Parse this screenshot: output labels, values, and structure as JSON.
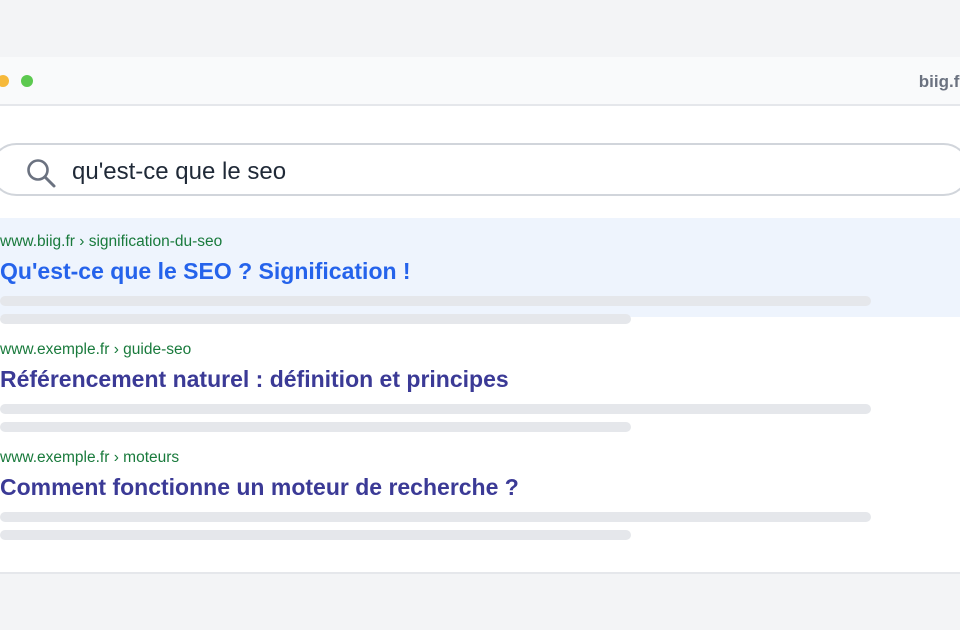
{
  "browser": {
    "domain": "biig.fr"
  },
  "search": {
    "query": "qu'est-ce que le seo"
  },
  "results": [
    {
      "url": "www.biig.fr › signification-du-seo",
      "title": "Qu'est-ce que le SEO ? Signification !",
      "title_color": "#2563eb",
      "highlighted": true
    },
    {
      "url": "www.exemple.fr › guide-seo",
      "title": "Référencement naturel : définition et principes",
      "title_color": "#3b3a96",
      "highlighted": false
    },
    {
      "url": "www.exemple.fr › moteurs",
      "title": "Comment fonctionne un moteur de recherche ?",
      "title_color": "#3b3a96",
      "highlighted": false
    }
  ],
  "colors": {
    "url_green": "#197a3c",
    "highlight_bg": "#eef4fd",
    "skeleton": "#e5e7eb"
  }
}
